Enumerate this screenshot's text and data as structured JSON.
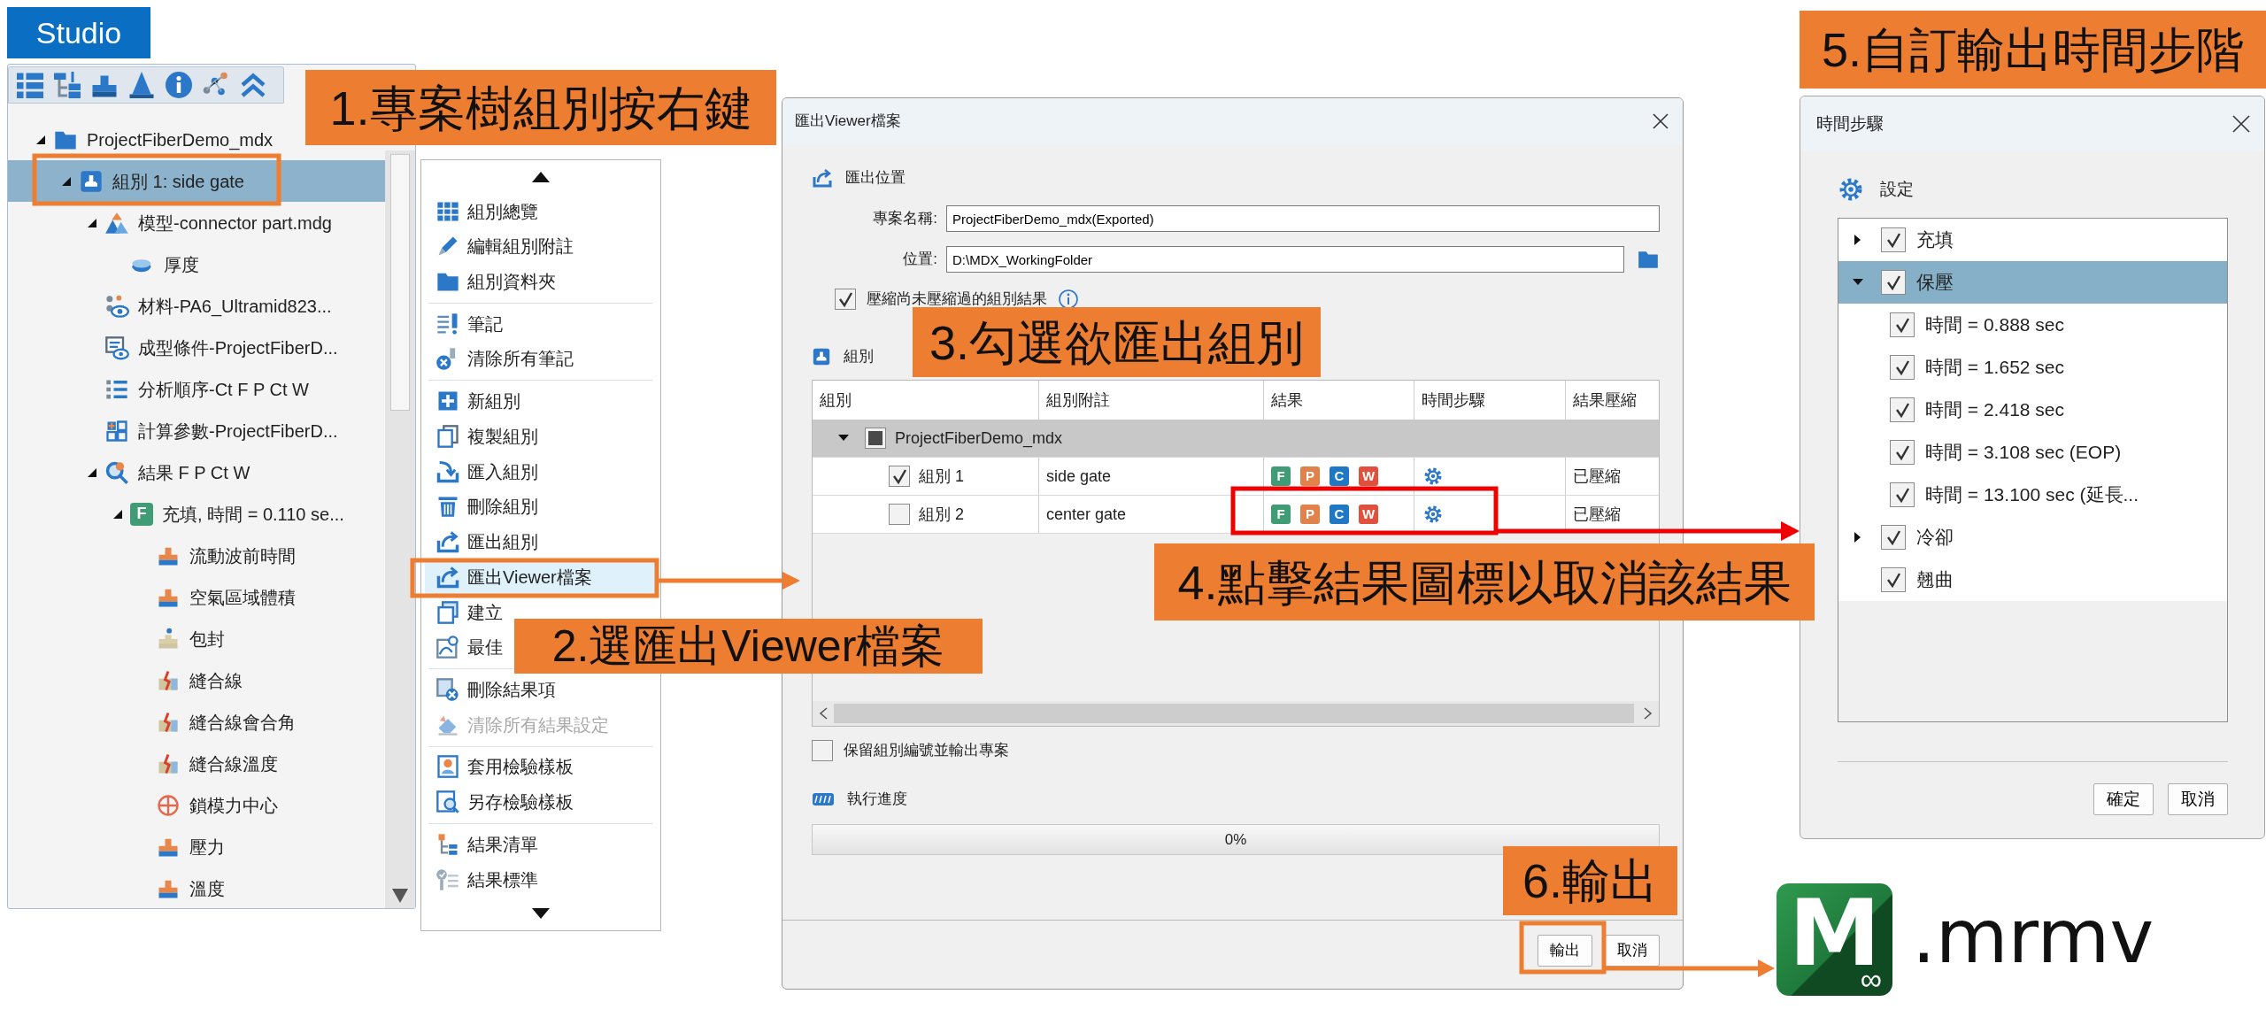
{
  "studio_tag": "Studio",
  "project_tree": {
    "items": [
      {
        "label": "ProjectFiberDemo_mdx",
        "kind": "project",
        "expanded": true,
        "selected": false,
        "children": [
          {
            "label": "組別 1: side gate",
            "kind": "group",
            "expanded": true,
            "selected": true,
            "children": [
              {
                "label": "模型-connector part.mdg",
                "kind": "model",
                "expanded": true,
                "selected": false,
                "children": [
                  {
                    "label": "厚度",
                    "kind": "thickness",
                    "selected": false
                  }
                ]
              },
              {
                "label": "材料-PA6_Ultramid823...",
                "kind": "material",
                "selected": false
              },
              {
                "label": "成型條件-ProjectFiberD...",
                "kind": "condition",
                "selected": false
              },
              {
                "label": "分析順序-Ct F P Ct W",
                "kind": "sequence",
                "selected": false
              },
              {
                "label": "計算參數-ProjectFiberD...",
                "kind": "parameters",
                "selected": false
              },
              {
                "label": "結果  F P Ct W",
                "kind": "results",
                "expanded": true,
                "selected": false,
                "children": [
                  {
                    "label": "充填, 時間 = 0.110 se...",
                    "kind": "fill",
                    "badge": "F",
                    "expanded": true,
                    "selected": false,
                    "children": [
                      {
                        "label": "流動波前時間",
                        "kind": "flow",
                        "selected": false
                      },
                      {
                        "label": "空氣區域體積",
                        "kind": "flow",
                        "selected": false
                      },
                      {
                        "label": "包封",
                        "kind": "air",
                        "selected": false
                      },
                      {
                        "label": "縫合線",
                        "kind": "weld",
                        "selected": false
                      },
                      {
                        "label": "縫合線會合角",
                        "kind": "weld",
                        "selected": false
                      },
                      {
                        "label": "縫合線溫度",
                        "kind": "weld",
                        "selected": false
                      },
                      {
                        "label": "鎖模力中心",
                        "kind": "target",
                        "selected": false
                      },
                      {
                        "label": "壓力",
                        "kind": "flow",
                        "selected": false
                      },
                      {
                        "label": "溫度",
                        "kind": "flow",
                        "selected": false
                      }
                    ]
                  }
                ]
              }
            ]
          }
        ]
      }
    ]
  },
  "context_menu": {
    "sections": [
      [
        {
          "label": "組別總覽",
          "kind": "overview",
          "selected": false,
          "disabled": false
        },
        {
          "label": "編輯組別附註",
          "kind": "edit",
          "selected": false,
          "disabled": false
        },
        {
          "label": "組別資料夾",
          "kind": "folder",
          "selected": false,
          "disabled": false
        }
      ],
      [
        {
          "label": "筆記",
          "kind": "note",
          "selected": false,
          "disabled": false
        },
        {
          "label": "清除所有筆記",
          "kind": "clear-notes",
          "selected": false,
          "disabled": false
        }
      ],
      [
        {
          "label": "新組別",
          "kind": "new",
          "selected": false,
          "disabled": false
        },
        {
          "label": "複製組別",
          "kind": "copy",
          "selected": false,
          "disabled": false
        },
        {
          "label": "匯入組別",
          "kind": "import",
          "selected": false,
          "disabled": false
        },
        {
          "label": "刪除組別",
          "kind": "delete",
          "selected": false,
          "disabled": false
        },
        {
          "label": "匯出組別",
          "kind": "export",
          "selected": false,
          "disabled": false
        },
        {
          "label": "匯出Viewer檔案",
          "kind": "export",
          "selected": true,
          "disabled": false
        },
        {
          "label": "建立",
          "kind": "report",
          "selected": false,
          "disabled": false
        },
        {
          "label": "最佳",
          "kind": "optimize",
          "selected": false,
          "disabled": false
        }
      ],
      [
        {
          "label": "刪除結果項",
          "kind": "delete-result",
          "selected": false,
          "disabled": false
        },
        {
          "label": "清除所有結果設定",
          "kind": "clear-results",
          "selected": false,
          "disabled": true
        }
      ],
      [
        {
          "label": "套用檢驗樣板",
          "kind": "apply-template",
          "selected": false,
          "disabled": false
        },
        {
          "label": "另存檢驗樣板",
          "kind": "save-template",
          "selected": false,
          "disabled": false
        }
      ],
      [
        {
          "label": "結果清單",
          "kind": "result-list",
          "selected": false,
          "disabled": false
        },
        {
          "label": "結果標準",
          "kind": "result-criteria",
          "selected": false,
          "disabled": false
        }
      ]
    ]
  },
  "export_dialog": {
    "title": "匯出Viewer檔案",
    "export_section": "匯出位置",
    "name_label": "專案名稱:",
    "name_value": "ProjectFiberDemo_mdx(Exported)",
    "location_label": "位置:",
    "location_value": "D:\\MDX_WorkingFolder",
    "compress": {
      "label": "壓縮尚未壓縮過的組別結果",
      "checked": true
    },
    "group_section": "組別",
    "columns": [
      "組別",
      "組別附註",
      "結果",
      "時間步驟",
      "結果壓縮"
    ],
    "project_row": {
      "label": "ProjectFiberDemo_mdx",
      "expanded": true,
      "indeterminate": true
    },
    "rows": [
      {
        "group": "組別 1",
        "note": "side gate",
        "checked": true,
        "results": [
          {
            "label": "F",
            "color": "#3f9c74"
          },
          {
            "label": "P",
            "color": "#e0824a"
          },
          {
            "label": "C",
            "color": "#1f78c4"
          },
          {
            "label": "W",
            "color": "#e0503c"
          }
        ],
        "compression": "已壓縮"
      },
      {
        "group": "組別 2",
        "note": "center gate",
        "checked": false,
        "results": [
          {
            "label": "F",
            "color": "#3f9c74"
          },
          {
            "label": "P",
            "color": "#e0824a"
          },
          {
            "label": "C",
            "color": "#1f78c4"
          },
          {
            "label": "W",
            "color": "#e0503c"
          }
        ],
        "compression": "已壓縮"
      }
    ],
    "keep_numbering": {
      "label": "保留組別編號並輸出專案",
      "checked": false
    },
    "progress_section": "執行進度",
    "progress": {
      "level": 0,
      "reading": "0%"
    },
    "buttons": [
      "輸出",
      "取消"
    ]
  },
  "timestep_dialog": {
    "title": "時間步驟",
    "section": "設定",
    "items": [
      {
        "label": "充填",
        "checked": true,
        "expanded": false,
        "selected": false
      },
      {
        "label": "保壓",
        "checked": true,
        "expanded": true,
        "selected": true,
        "children": [
          {
            "label": "時間 = 0.888 sec",
            "checked": true,
            "selected": false
          },
          {
            "label": "時間 = 1.652 sec",
            "checked": true,
            "selected": false
          },
          {
            "label": "時間 = 2.418 sec",
            "checked": true,
            "selected": false
          },
          {
            "label": "時間 = 3.108 sec (EOP)",
            "checked": true,
            "selected": false
          },
          {
            "label": "時間 = 13.100 sec (延長...",
            "checked": true,
            "selected": false
          }
        ]
      },
      {
        "label": "冷卻",
        "checked": true,
        "expanded": false,
        "selected": false
      },
      {
        "label": "翹曲",
        "checked": true,
        "selected": false
      }
    ],
    "buttons": [
      "確定",
      "取消"
    ]
  },
  "callouts": [
    "1.專案樹組別按右鍵",
    "2.選匯出Viewer檔案",
    "3.勾選欲匯出組別",
    "4.點擊結果圖標以取消該結果",
    "5.自訂輸出時間步階",
    "6.輸出"
  ],
  "output_file": {
    "logo_letter": "M",
    "logo_mark": "∞",
    "extension": ".mrmv"
  }
}
